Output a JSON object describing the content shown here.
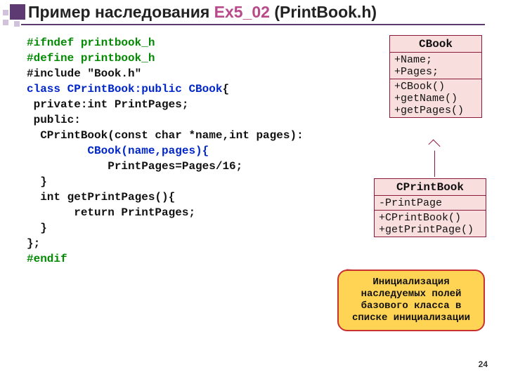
{
  "title": {
    "pre": "Пример наследования ",
    "accent": "Ex5_02",
    "post": " (PrintBook.h)"
  },
  "code": {
    "l1": "#ifndef printbook_h",
    "l2": "#define printbook_h",
    "l3a": "#include ",
    "l3b": "\"Book.h\"",
    "l4a": "class CPrintBook:public ",
    "l4b": "CBook",
    "l4c": "{",
    "l5": " private:int PrintPages;",
    "l6": " public:",
    "l7": "  CPrintBook(const char *name,int pages):",
    "l8": "         CBook(name,pages){",
    "l9": "            PrintPages=Pages/16;",
    "l10": "  }",
    "l11": "  int getPrintPages(){",
    "l12": "       return PrintPages;",
    "l13": "  }",
    "l14": "}; ",
    "l15": "#endif"
  },
  "uml_cbook": {
    "name": "CBook",
    "attr1": "+Name;",
    "attr2": "+Pages;",
    "op1": "+CBook()",
    "op2": "+getName()",
    "op3": "+getPages()"
  },
  "uml_cprint": {
    "name": "CPrintBook",
    "attr1": "-PrintPage",
    "op1": "+CPrintBook()",
    "op2": "+getPrintPage()"
  },
  "callout": {
    "l1": "Инициализация",
    "l2": "наследуемых полей",
    "l3": "базового класса в",
    "l4": "списке инициализации"
  },
  "pagenum": "24"
}
